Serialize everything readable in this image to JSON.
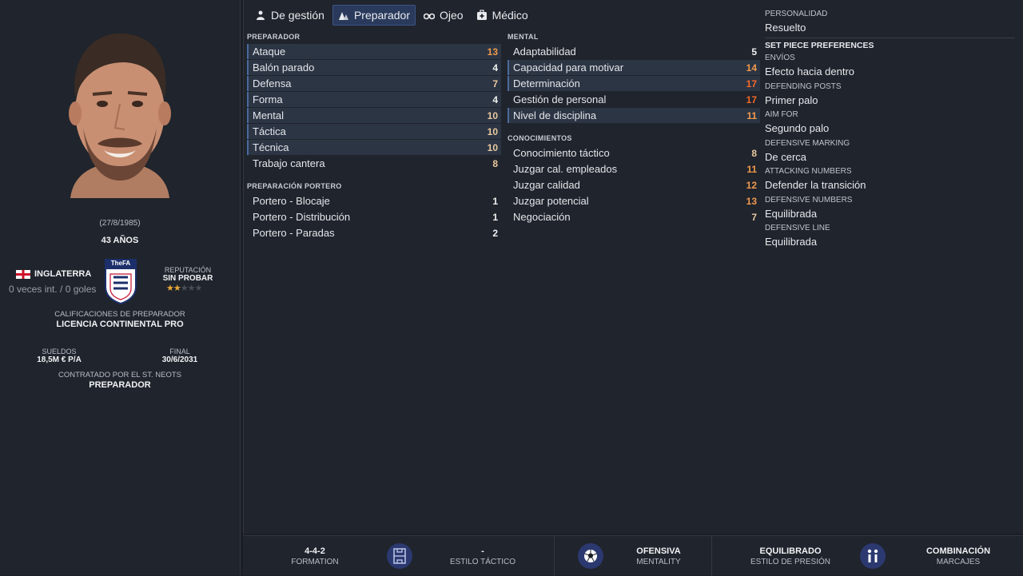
{
  "tabs": [
    {
      "label": "De gestión",
      "icon": "manager-icon"
    },
    {
      "label": "Preparador",
      "icon": "cones-icon",
      "active": true
    },
    {
      "label": "Ojeo",
      "icon": "binoculars-icon"
    },
    {
      "label": "Médico",
      "icon": "medkit-icon"
    }
  ],
  "profile": {
    "dob": "(27/8/1985)",
    "age": "43 AÑOS",
    "nation": "INGLATERRA",
    "caps": "0 veces int. / 0 goles",
    "rep_label": "REPUTACIÓN",
    "rep_value": "SIN PROBAR",
    "rep_stars": 2,
    "rep_max": 5,
    "qual_label": "CALIFICACIONES DE PREPARADOR",
    "qual_value": "LICENCIA CONTINENTAL PRO",
    "crest_text": "TheFA",
    "wage_label": "SUELDOS",
    "wage_value": "18,5M € P/A",
    "end_label": "FINAL",
    "end_value": "30/6/2031",
    "contract_label": "CONTRATADO POR EL ST. NEOTS",
    "contract_value": "PREPARADOR"
  },
  "preparador": {
    "title": "PREPARADOR",
    "items": [
      {
        "label": "Ataque",
        "value": "13"
      },
      {
        "label": "Balón parado",
        "value": "4"
      },
      {
        "label": "Defensa",
        "value": "7"
      },
      {
        "label": "Forma",
        "value": "4"
      },
      {
        "label": "Mental",
        "value": "10"
      },
      {
        "label": "Táctica",
        "value": "10"
      },
      {
        "label": "Técnica",
        "value": "10"
      },
      {
        "label": "Trabajo cantera",
        "value": "8"
      }
    ]
  },
  "portero": {
    "title": "PREPARACIÓN PORTERO",
    "items": [
      {
        "label": "Portero - Blocaje",
        "value": "1"
      },
      {
        "label": "Portero - Distribución",
        "value": "1"
      },
      {
        "label": "Portero - Paradas",
        "value": "2"
      }
    ]
  },
  "mental": {
    "title": "MENTAL",
    "items": [
      {
        "label": "Adaptabilidad",
        "value": "5"
      },
      {
        "label": "Capacidad para motivar",
        "value": "14"
      },
      {
        "label": "Determinación",
        "value": "17"
      },
      {
        "label": "Gestión de personal",
        "value": "17"
      },
      {
        "label": "Nivel de disciplina",
        "value": "11"
      }
    ]
  },
  "conocimientos": {
    "title": "CONOCIMIENTOS",
    "items": [
      {
        "label": "Conocimiento táctico",
        "value": "8"
      },
      {
        "label": "Juzgar cal. empleados",
        "value": "11"
      },
      {
        "label": "Juzgar calidad",
        "value": "12"
      },
      {
        "label": "Juzgar potencial",
        "value": "13"
      },
      {
        "label": "Negociación",
        "value": "7"
      }
    ]
  },
  "prefs": {
    "personality_label": "PERSONALIDAD",
    "personality_value": "Resuelto",
    "heading": "SET PIECE PREFERENCES",
    "items": [
      {
        "label": "ENVÍOS",
        "value": "Efecto hacia dentro"
      },
      {
        "label": "DEFENDING POSTS",
        "value": "Primer palo"
      },
      {
        "label": "AIM FOR",
        "value": "Segundo palo"
      },
      {
        "label": "DEFENSIVE MARKING",
        "value": "De cerca"
      },
      {
        "label": "ATTACKING NUMBERS",
        "value": "Defender la transición"
      },
      {
        "label": "DEFENSIVE NUMBERS",
        "value": "Equilibrada"
      },
      {
        "label": "DEFENSIVE LINE",
        "value": "Equilibrada"
      }
    ]
  },
  "bottom": [
    {
      "value": "4-4-2",
      "label": "FORMATION"
    },
    {
      "value": "-",
      "label": "ESTILO TÁCTICO"
    },
    {
      "value": "OFENSIVA",
      "label": "MENTALITY"
    },
    {
      "value": "EQUILIBRADO",
      "label": "ESTILO DE PRESIÓN"
    },
    {
      "value": "COMBINACIÓN",
      "label": "MARCAJES"
    }
  ],
  "colors": {
    "accent": "#2a3a5c",
    "low": "#e8c9a0",
    "mid": "#f09a4e",
    "high": "#f26a2a"
  }
}
